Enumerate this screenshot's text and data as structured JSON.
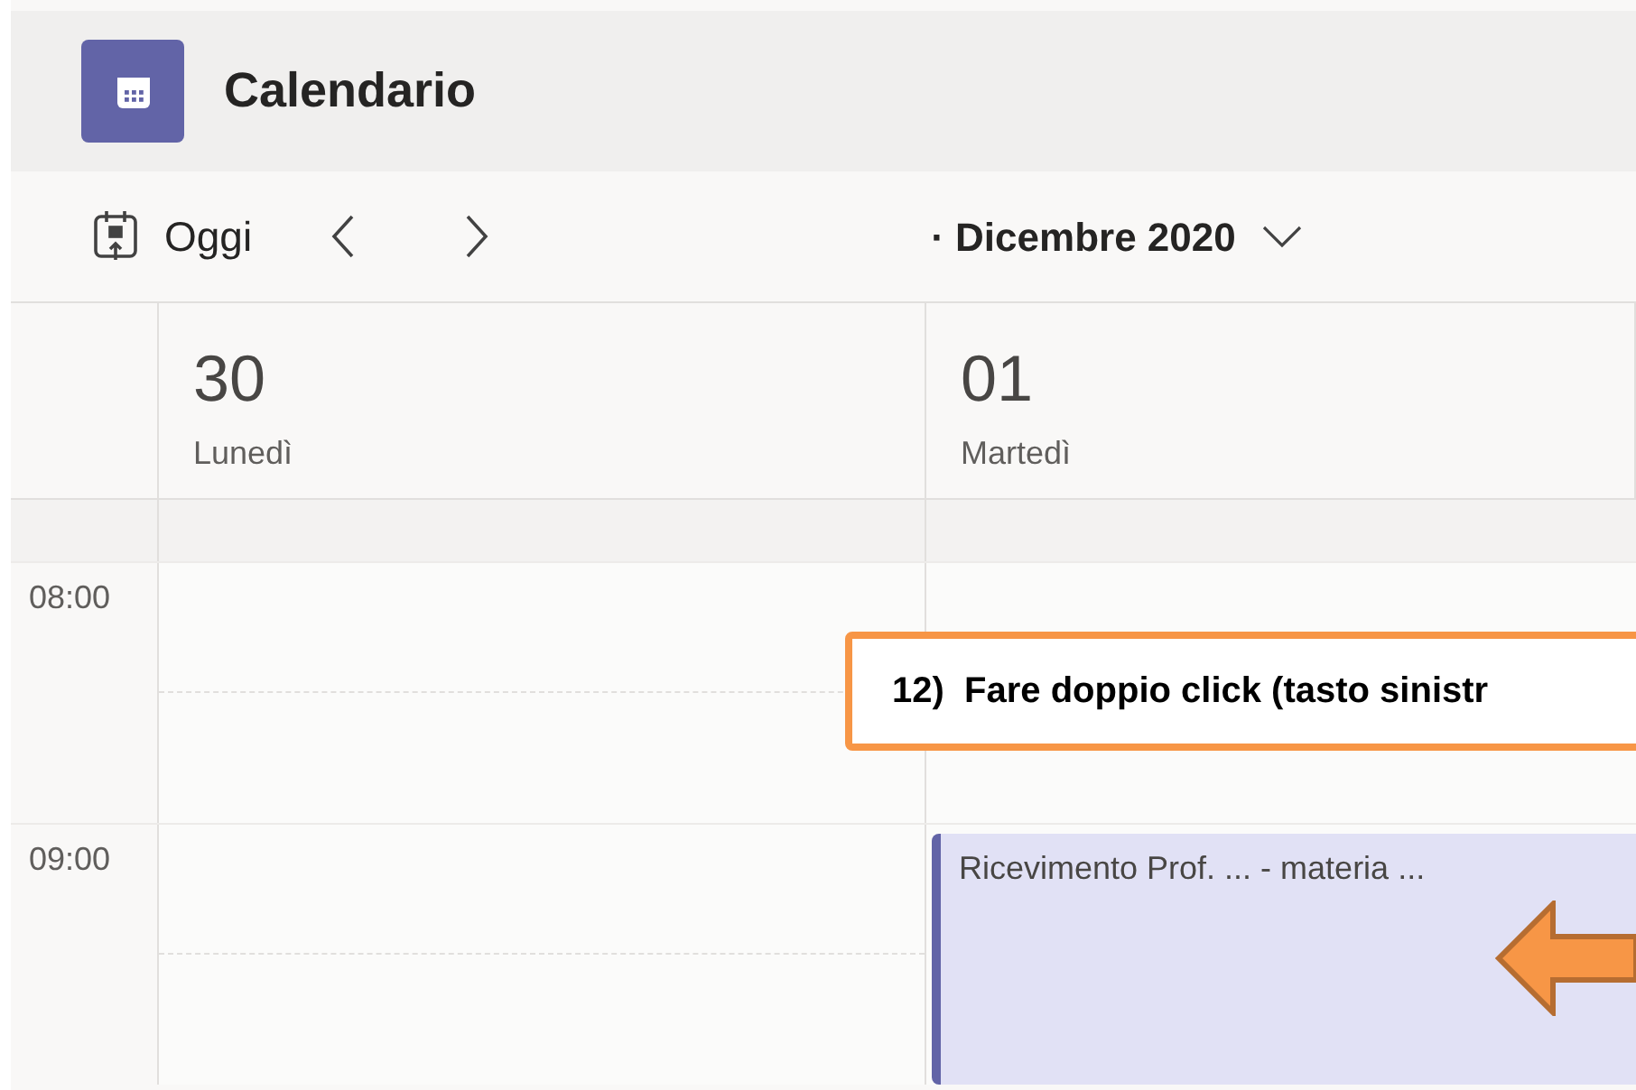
{
  "header": {
    "title": "Calendario"
  },
  "toolbar": {
    "today": "Oggi",
    "month": "· Dicembre 2020"
  },
  "days": [
    {
      "number": "30",
      "weekday": "Lunedì"
    },
    {
      "number": "01",
      "weekday": "Martedì"
    }
  ],
  "hours": [
    "08:00",
    "09:00"
  ],
  "event": {
    "title": "Ricevimento Prof. ... - materia ..."
  },
  "callout": {
    "text": "12)  Fare doppio click (tasto sinistr"
  }
}
